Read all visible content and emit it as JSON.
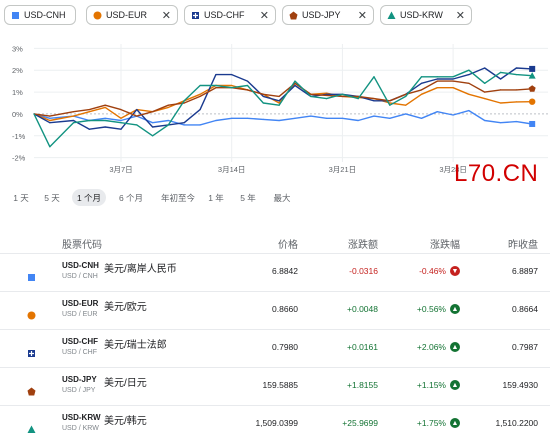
{
  "chips": [
    {
      "label": "USD-CNH",
      "color": "#4285f4",
      "marker": "square",
      "closable": false
    },
    {
      "label": "USD-EUR",
      "color": "#e37400",
      "marker": "circle",
      "closable": true
    },
    {
      "label": "USD-CHF",
      "color": "#1a3a8f",
      "marker": "cross-square",
      "closable": true
    },
    {
      "label": "USD-JPY",
      "color": "#a0400f",
      "marker": "pentagon",
      "closable": true
    },
    {
      "label": "USD-KRW",
      "color": "#129381",
      "marker": "triangle",
      "closable": true
    }
  ],
  "close_glyph": "✕",
  "chart_data": {
    "type": "line",
    "ylabel": "",
    "yticks": [
      "3%",
      "2%",
      "1%",
      "0%",
      "-1%",
      "-2%"
    ],
    "ylim": [
      -2.2,
      3.2
    ],
    "xticks": [
      {
        "label": "3月7日",
        "day": 7
      },
      {
        "label": "3月14日",
        "day": 14
      },
      {
        "label": "3月21日",
        "day": 21
      },
      {
        "label": "3月28日",
        "day": 28
      }
    ],
    "x_range": [
      1.5,
      34
    ],
    "series": [
      {
        "name": "USD-CNH",
        "color": "#4285f4",
        "values": [
          [
            1.5,
            0
          ],
          [
            2.5,
            -0.2
          ],
          [
            4,
            -0.1
          ],
          [
            5,
            -0.3
          ],
          [
            6,
            -0.2
          ],
          [
            7,
            -0.3
          ],
          [
            8,
            -0.1
          ],
          [
            9,
            -0.4
          ],
          [
            10,
            -0.3
          ],
          [
            11,
            -0.5
          ],
          [
            12,
            -0.5
          ],
          [
            13,
            -0.3
          ],
          [
            14,
            -0.2
          ],
          [
            15,
            -0.2
          ],
          [
            16,
            -0.25
          ],
          [
            17,
            -0.3
          ],
          [
            18,
            -0.2
          ],
          [
            19,
            -0.1
          ],
          [
            20,
            -0.2
          ],
          [
            21,
            -0.2
          ],
          [
            22,
            -0.3
          ],
          [
            23,
            -0.1
          ],
          [
            24,
            -0.2
          ],
          [
            25,
            0
          ],
          [
            26,
            -0.2
          ],
          [
            27,
            0.1
          ],
          [
            28,
            -0.05
          ],
          [
            29,
            0.15
          ],
          [
            30,
            -0.3
          ],
          [
            31,
            -0.4
          ],
          [
            32,
            -0.35
          ],
          [
            33,
            -0.46
          ]
        ]
      },
      {
        "name": "USD-EUR",
        "color": "#e37400",
        "values": [
          [
            1.5,
            0
          ],
          [
            2.5,
            -0.3
          ],
          [
            4,
            -0.1
          ],
          [
            5,
            0.1
          ],
          [
            6,
            0.3
          ],
          [
            7,
            -0.2
          ],
          [
            8,
            0.2
          ],
          [
            9,
            0.1
          ],
          [
            10,
            0.3
          ],
          [
            11,
            0.6
          ],
          [
            12,
            0.9
          ],
          [
            13,
            1.3
          ],
          [
            14,
            1.3
          ],
          [
            15,
            1.1
          ],
          [
            16,
            0.9
          ],
          [
            17,
            0.5
          ],
          [
            18,
            1.4
          ],
          [
            19,
            0.9
          ],
          [
            20,
            0.95
          ],
          [
            21,
            0.8
          ],
          [
            22,
            0.75
          ],
          [
            23,
            0.7
          ],
          [
            24,
            0.5
          ],
          [
            25,
            0.4
          ],
          [
            26,
            0.9
          ],
          [
            27,
            1.2
          ],
          [
            28,
            1.2
          ],
          [
            29,
            0.9
          ],
          [
            30,
            0.7
          ],
          [
            31,
            0.5
          ],
          [
            32,
            0.55
          ],
          [
            33,
            0.56
          ]
        ]
      },
      {
        "name": "USD-CHF",
        "color": "#1a3a8f",
        "values": [
          [
            1.5,
            0
          ],
          [
            2.5,
            -0.4
          ],
          [
            4,
            -0.3
          ],
          [
            5,
            -0.7
          ],
          [
            6,
            -0.6
          ],
          [
            7,
            -0.7
          ],
          [
            8,
            0.2
          ],
          [
            9,
            -0.6
          ],
          [
            10,
            -0.5
          ],
          [
            11,
            -0.4
          ],
          [
            12,
            0.2
          ],
          [
            13,
            1.8
          ],
          [
            14,
            1.8
          ],
          [
            15,
            1.5
          ],
          [
            16,
            0.8
          ],
          [
            17,
            0.6
          ],
          [
            18,
            1.3
          ],
          [
            19,
            0.8
          ],
          [
            20,
            0.9
          ],
          [
            21,
            0.9
          ],
          [
            22,
            0.8
          ],
          [
            23,
            0.6
          ],
          [
            24,
            0.6
          ],
          [
            25,
            0.9
          ],
          [
            26,
            1.4
          ],
          [
            27,
            1.6
          ],
          [
            28,
            1.6
          ],
          [
            29,
            1.8
          ],
          [
            30,
            2.1
          ],
          [
            31,
            1.6
          ],
          [
            32,
            2.1
          ],
          [
            33,
            2.06
          ]
        ]
      },
      {
        "name": "USD-JPY",
        "color": "#a0400f",
        "values": [
          [
            1.5,
            0
          ],
          [
            2.5,
            -0.1
          ],
          [
            4,
            0.1
          ],
          [
            5,
            0.2
          ],
          [
            6,
            0.4
          ],
          [
            7,
            0.2
          ],
          [
            8,
            -0.1
          ],
          [
            9,
            0.1
          ],
          [
            10,
            0.4
          ],
          [
            11,
            0.5
          ],
          [
            12,
            0.8
          ],
          [
            13,
            1.2
          ],
          [
            14,
            1.2
          ],
          [
            15,
            1.1
          ],
          [
            16,
            0.9
          ],
          [
            17,
            0.8
          ],
          [
            18,
            1.4
          ],
          [
            19,
            0.9
          ],
          [
            20,
            0.85
          ],
          [
            21,
            0.8
          ],
          [
            22,
            0.8
          ],
          [
            23,
            0.7
          ],
          [
            24,
            0.6
          ],
          [
            25,
            0.9
          ],
          [
            26,
            1.1
          ],
          [
            27,
            1.5
          ],
          [
            28,
            1.5
          ],
          [
            29,
            1.4
          ],
          [
            30,
            1.0
          ],
          [
            31,
            1.1
          ],
          [
            32,
            1.1
          ],
          [
            33,
            1.15
          ]
        ]
      },
      {
        "name": "USD-KRW",
        "color": "#129381",
        "values": [
          [
            1.5,
            0
          ],
          [
            2.5,
            -1.5
          ],
          [
            4,
            -0.4
          ],
          [
            5,
            -0.3
          ],
          [
            6,
            -0.3
          ],
          [
            7,
            -0.4
          ],
          [
            8,
            -0.5
          ],
          [
            9,
            -1.0
          ],
          [
            10,
            -0.5
          ],
          [
            11,
            0.6
          ],
          [
            12,
            1.3
          ],
          [
            13,
            1.3
          ],
          [
            14,
            1.2
          ],
          [
            15,
            1.3
          ],
          [
            16,
            0.5
          ],
          [
            17,
            0.4
          ],
          [
            18,
            1.5
          ],
          [
            19,
            0.8
          ],
          [
            20,
            0.7
          ],
          [
            21,
            0.9
          ],
          [
            22,
            0.7
          ],
          [
            23,
            1.7
          ],
          [
            24,
            0.4
          ],
          [
            25,
            0.8
          ],
          [
            26,
            1.7
          ],
          [
            27,
            1.7
          ],
          [
            28,
            1.7
          ],
          [
            29,
            2.0
          ],
          [
            30,
            1.4
          ],
          [
            31,
            1.9
          ],
          [
            32,
            1.8
          ],
          [
            33,
            1.75
          ]
        ]
      }
    ]
  },
  "watermark": "L70.CN",
  "ranges": [
    {
      "label": "1 天",
      "active": false
    },
    {
      "label": "5 天",
      "active": false
    },
    {
      "label": "1 个月",
      "active": true
    },
    {
      "label": "6 个月",
      "active": false
    },
    {
      "label": "年初至今",
      "active": false
    },
    {
      "label": "1 年",
      "active": false
    },
    {
      "label": "5 年",
      "active": false
    },
    {
      "label": "最大",
      "active": false
    }
  ],
  "table": {
    "headers": {
      "code": "股票代码",
      "price": "价格",
      "change": "涨跌额",
      "pct": "涨跌幅",
      "prev": "昨收盘"
    },
    "rows": [
      {
        "code": "USD-CNH",
        "name": "美元/离岸人民币",
        "sub": "USD / CNH",
        "price": "6.8842",
        "change": "-0.0316",
        "pct": "-0.46%",
        "dir": "down",
        "prev": "6.8897",
        "color": "#4285f4",
        "marker": "square"
      },
      {
        "code": "USD-EUR",
        "name": "美元/欧元",
        "sub": "USD / EUR",
        "price": "0.8660",
        "change": "+0.0048",
        "pct": "+0.56%",
        "dir": "up",
        "prev": "0.8664",
        "color": "#e37400",
        "marker": "circle"
      },
      {
        "code": "USD-CHF",
        "name": "美元/瑞士法郎",
        "sub": "USD / CHF",
        "price": "0.7980",
        "change": "+0.0161",
        "pct": "+2.06%",
        "dir": "up",
        "prev": "0.7987",
        "color": "#1a3a8f",
        "marker": "cross-square"
      },
      {
        "code": "USD-JPY",
        "name": "美元/日元",
        "sub": "USD / JPY",
        "price": "159.5885",
        "change": "+1.8155",
        "pct": "+1.15%",
        "dir": "up",
        "prev": "159.4930",
        "color": "#a0400f",
        "marker": "pentagon"
      },
      {
        "code": "USD-KRW",
        "name": "美元/韩元",
        "sub": "USD / KRW",
        "price": "1,509.0399",
        "change": "+25.9699",
        "pct": "+1.75%",
        "dir": "up",
        "prev": "1,510.2200",
        "color": "#129381",
        "marker": "triangle"
      }
    ]
  }
}
